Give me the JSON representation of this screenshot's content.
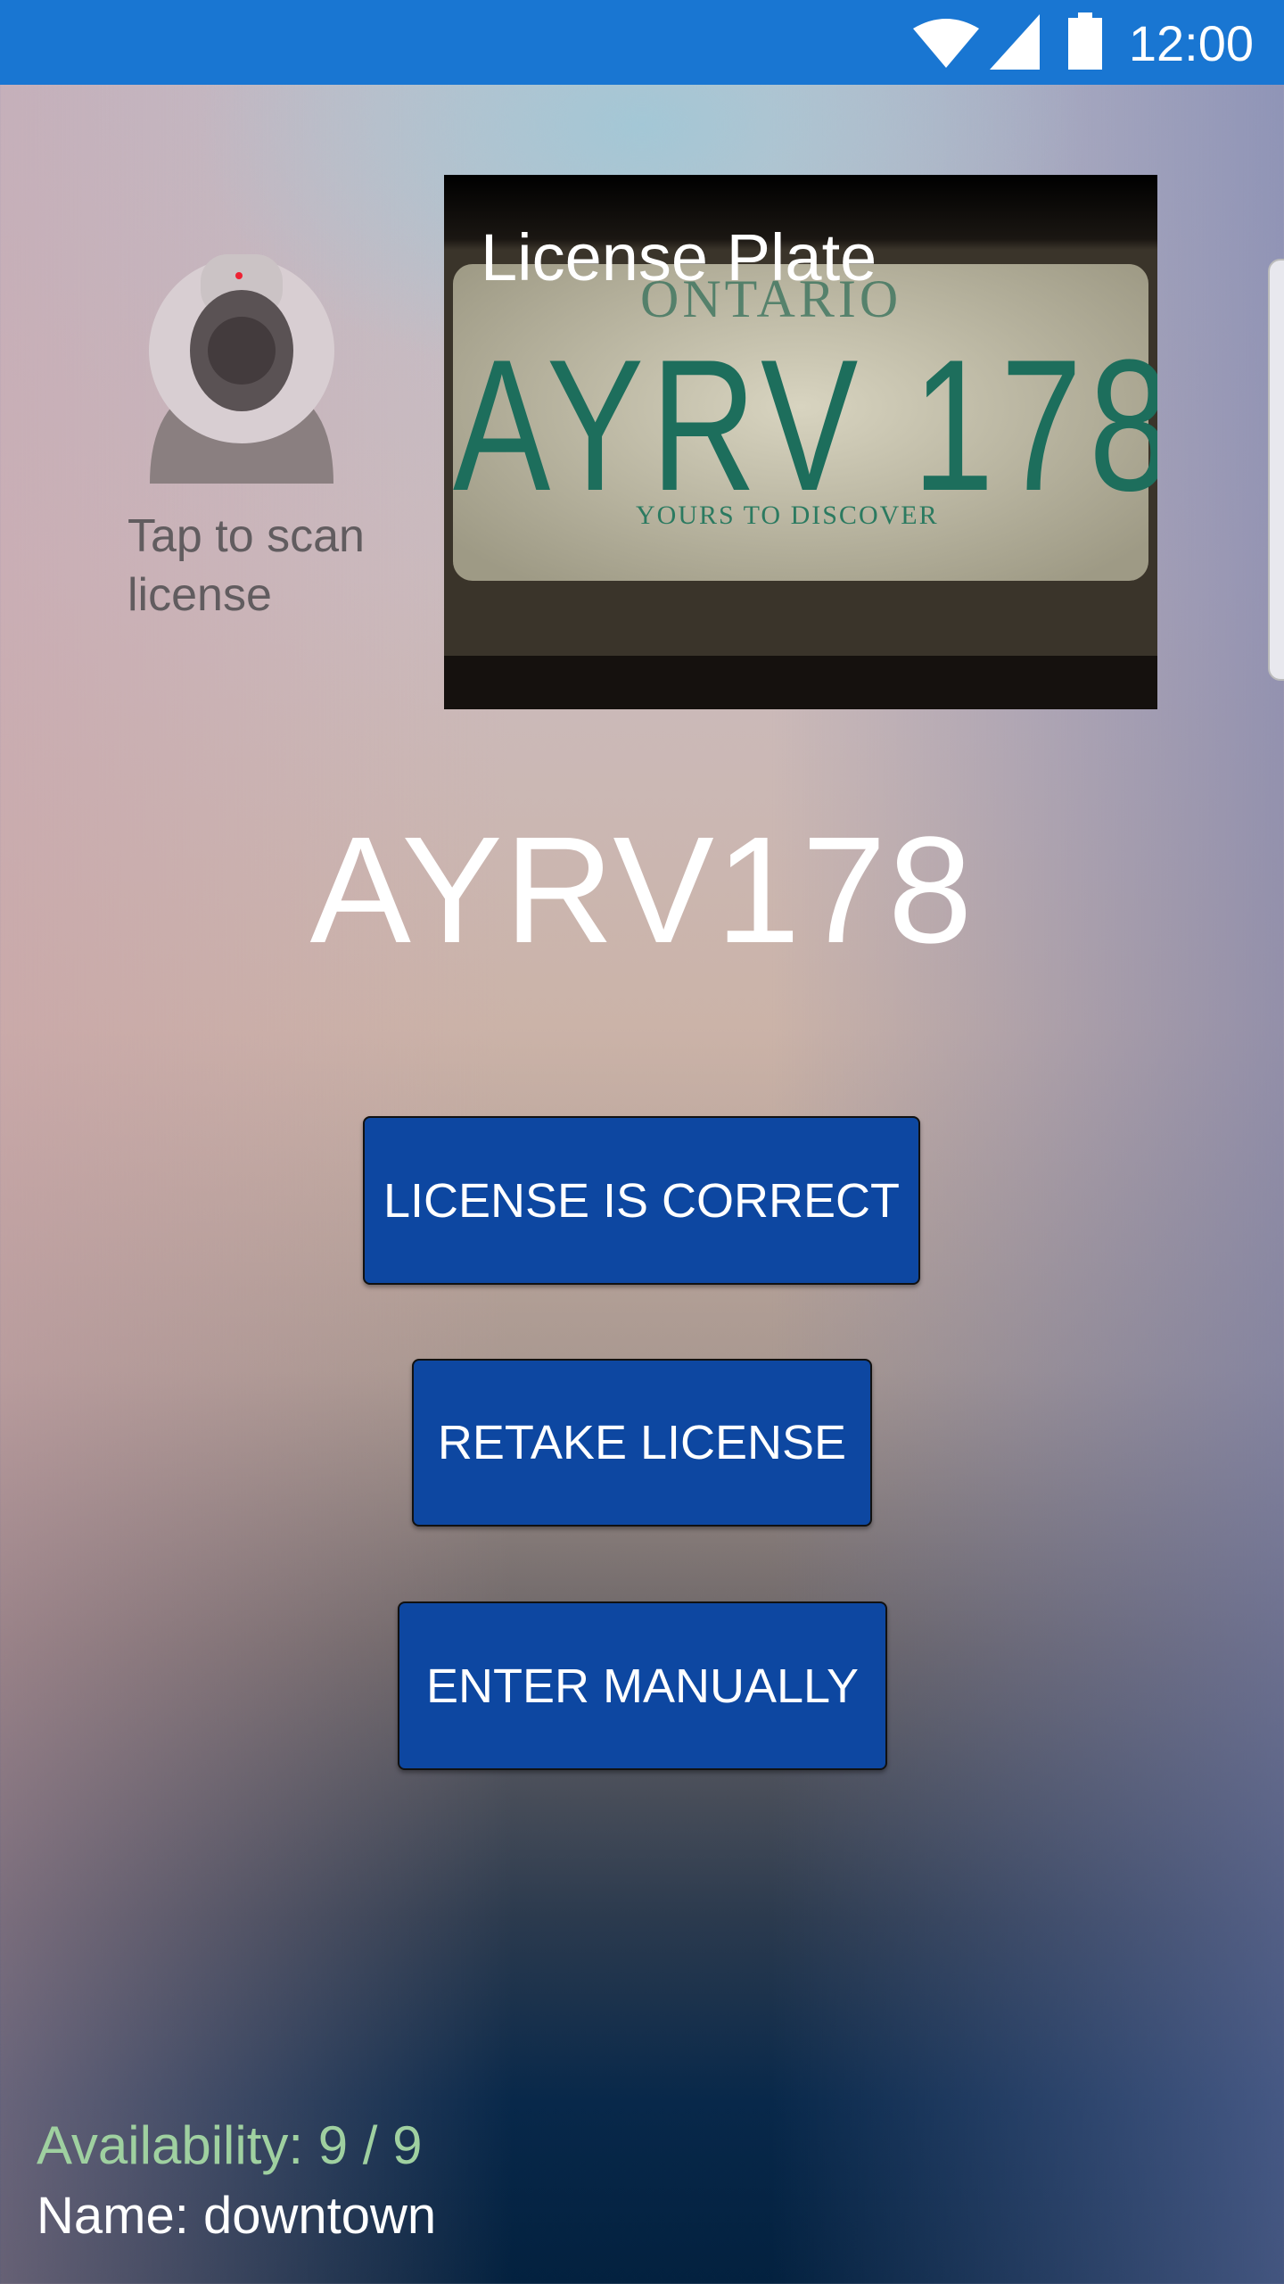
{
  "status_bar": {
    "time": "12:00",
    "icons": [
      "wifi-icon",
      "cell-signal-icon",
      "battery-icon"
    ],
    "color": "#1976d2"
  },
  "scanner": {
    "icon": "webcam-icon",
    "label": "Tap to scan license"
  },
  "photo": {
    "title": "License Plate",
    "plate_province": "ONTARIO",
    "plate_text": "AYRV 178",
    "plate_motto": "YOURS TO DISCOVER"
  },
  "recognized_plate": "AYRV178",
  "buttons": {
    "correct": "LICENSE IS CORRECT",
    "retake": "RETAKE LICENSE",
    "manual": "ENTER MANUALLY",
    "color": "#0d47a1"
  },
  "footer": {
    "availability": "Availability: 9 / 9",
    "name": "Name: downtown",
    "availability_color": "#9fd0a0"
  }
}
